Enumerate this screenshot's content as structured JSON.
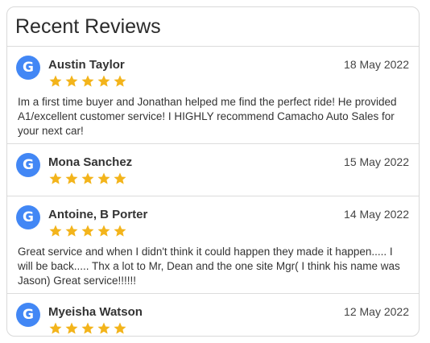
{
  "widget": {
    "title": "Recent Reviews"
  },
  "reviews": [
    {
      "badge": "G",
      "name": "Austin Taylor",
      "date": "18 May 2022",
      "stars": 5,
      "text": "Im a first time buyer and Jonathan helped me find the perfect ride! He provided A1/excellent customer service! I HIGHLY recommend Camacho Auto Sales for your next car!"
    },
    {
      "badge": "G",
      "name": "Mona Sanchez",
      "date": "15 May 2022",
      "stars": 5,
      "text": ""
    },
    {
      "badge": "G",
      "name": "Antoine, B Porter",
      "date": "14 May 2022",
      "stars": 5,
      "text": "Great service and when I didn't think it could happen they made it happen..... I will be back..... Thx a lot to Mr, Dean and the one site Mgr( I think his name was Jason) Great service!!!!!!"
    },
    {
      "badge": "G",
      "name": "Myeisha Watson",
      "date": "12 May 2022",
      "stars": 5,
      "text": ""
    }
  ],
  "colors": {
    "badge": "#4287f5",
    "star": "#f3b41b",
    "border": "#dcdcdc"
  },
  "icons": {
    "badge": "google-g-icon",
    "star": "star-icon"
  }
}
